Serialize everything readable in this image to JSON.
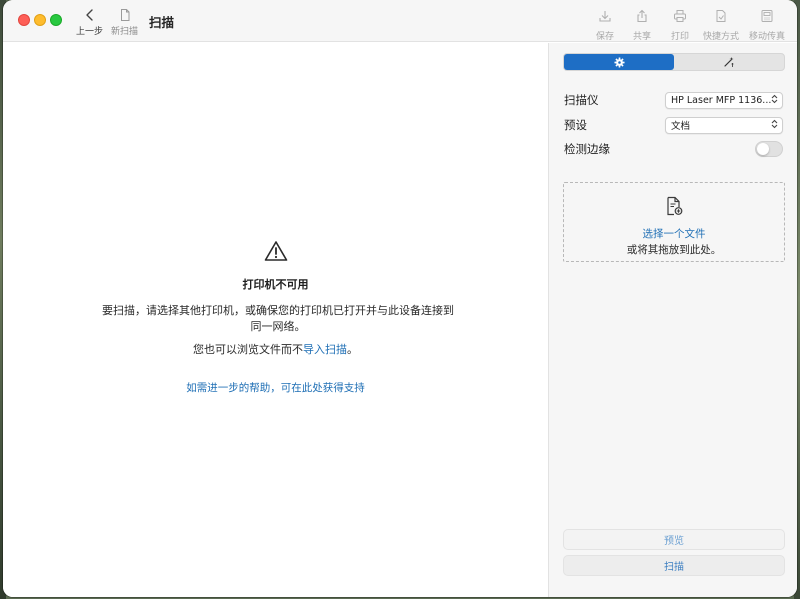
{
  "window": {
    "title": "扫描"
  },
  "toolbar": {
    "back_label": "上一步",
    "new_scan_label": "新扫描",
    "save_label": "保存",
    "share_label": "共享",
    "print_label": "打印",
    "shortcut_label": "快捷方式",
    "mobile_fax_label": "移动传真"
  },
  "main": {
    "message_title": "打印机不可用",
    "message_body": "要扫描，请选择其他打印机，或确保您的打印机已打开并与此设备连接到同一网络。",
    "alt_prefix": "您也可以浏览文件而不",
    "alt_link": "导入扫描",
    "alt_suffix": "。",
    "help_link": "如需进一步的帮助，可在此处获得支持"
  },
  "sidebar": {
    "tabs": [
      {
        "icon": "gear-icon",
        "selected": true
      },
      {
        "icon": "magic-wand-icon",
        "selected": false
      }
    ],
    "scanner_label": "扫描仪",
    "scanner_value": "HP Laser MFP 1136...",
    "preset_label": "预设",
    "preset_value": "文档",
    "detect_edges_label": "检测边缘",
    "detect_edges_on": false,
    "dropzone_choose": "选择一个文件",
    "dropzone_drop": "或将其拖放到此处。",
    "preview_button": "预览",
    "scan_button": "扫描"
  },
  "colors": {
    "accent": "#1e6ec5",
    "link": "#1f6fb5"
  }
}
